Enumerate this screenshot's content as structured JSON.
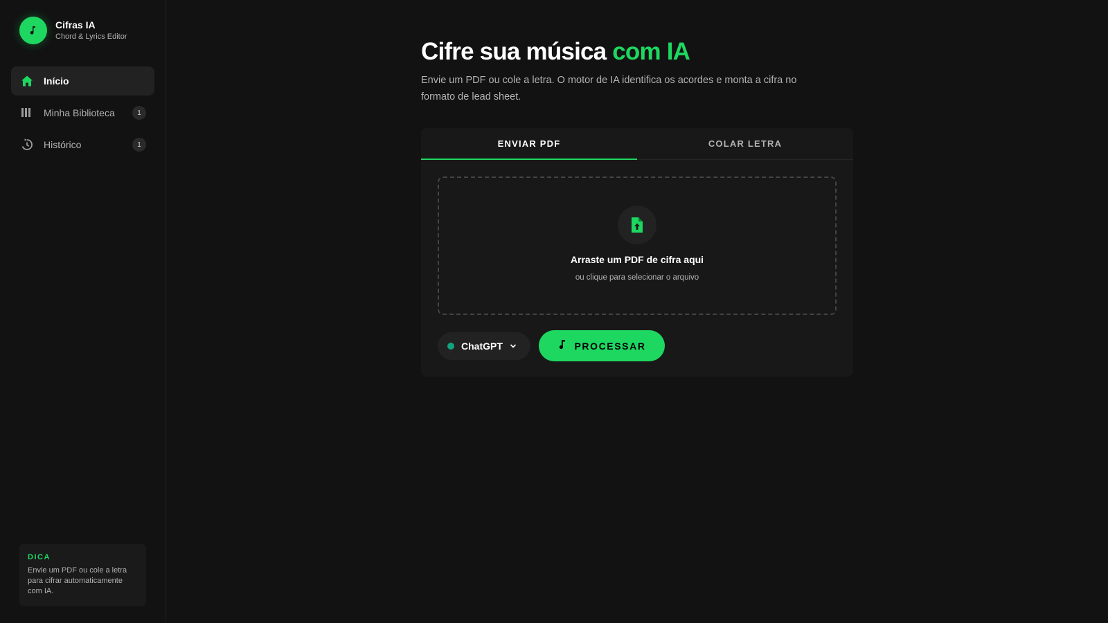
{
  "brand": {
    "name": "Cifras IA",
    "subtitle": "Chord & Lyrics Editor",
    "logo_icon": "music-note-icon"
  },
  "sidebar": {
    "items": [
      {
        "label": "Início",
        "icon": "home-icon",
        "active": true,
        "badge": null
      },
      {
        "label": "Minha Biblioteca",
        "icon": "library-icon",
        "active": false,
        "badge": "1"
      },
      {
        "label": "Histórico",
        "icon": "history-icon",
        "active": false,
        "badge": "1"
      }
    ],
    "tip": {
      "title": "DICA",
      "text": "Envie um PDF ou cole a letra para cifrar automaticamente com IA."
    }
  },
  "main": {
    "title_prefix": "Cifre sua música ",
    "title_accent": "com IA",
    "description": "Envie um PDF ou cole a letra. O motor de IA identifica os acordes e monta a cifra no formato de lead sheet.",
    "tabs": [
      {
        "label": "ENVIAR PDF",
        "active": true
      },
      {
        "label": "COLAR LETRA",
        "active": false
      }
    ],
    "dropzone": {
      "icon": "file-upload-icon",
      "title": "Arraste um PDF de cifra aqui",
      "subtitle": "ou clique para selecionar o arquivo"
    },
    "model_select": {
      "value": "ChatGPT",
      "dot_color": "#10a37f"
    },
    "process_button": {
      "label": "PROCESSAR",
      "icon": "music-note-icon"
    }
  },
  "colors": {
    "accent": "#1ed760",
    "background": "#121212",
    "surface": "#181818"
  }
}
